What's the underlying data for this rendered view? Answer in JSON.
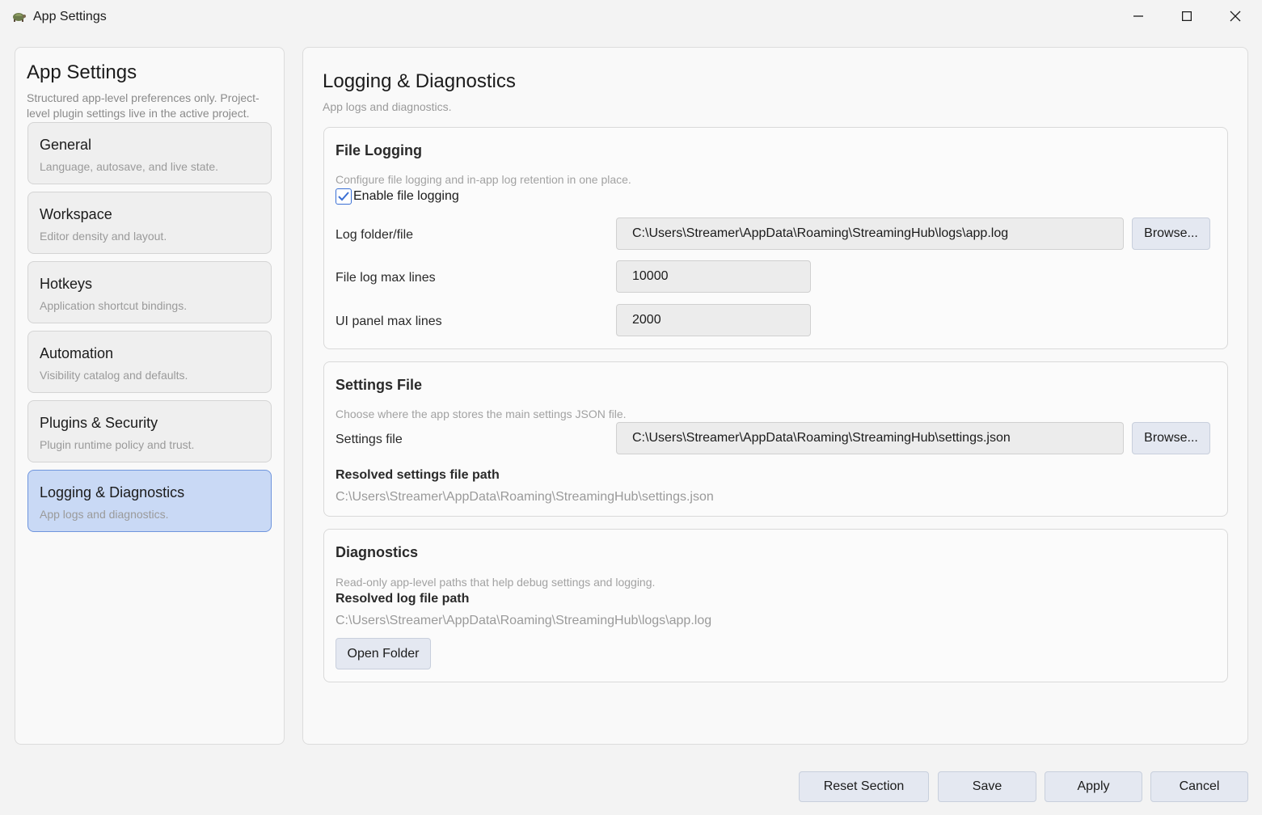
{
  "window": {
    "title": "App Settings",
    "icon": "turtle-app-icon"
  },
  "sidebar": {
    "title": "App Settings",
    "description": "Structured app-level preferences only. Project-level plugin settings live in the active project.",
    "items": [
      {
        "label": "General",
        "sub": "Language, autosave, and live state.",
        "active": false
      },
      {
        "label": "Workspace",
        "sub": "Editor density and layout.",
        "active": false
      },
      {
        "label": "Hotkeys",
        "sub": "Application shortcut bindings.",
        "active": false
      },
      {
        "label": "Automation",
        "sub": "Visibility catalog and defaults.",
        "active": false
      },
      {
        "label": "Plugins & Security",
        "sub": "Plugin runtime policy and trust.",
        "active": false
      },
      {
        "label": "Logging & Diagnostics",
        "sub": "App logs and diagnostics.",
        "active": true
      }
    ]
  },
  "main": {
    "title": "Logging & Diagnostics",
    "description": "App logs and diagnostics.",
    "file_logging": {
      "title": "File Logging",
      "description": "Configure file logging and in-app log retention in one place.",
      "enable_label": "Enable file logging",
      "enabled": true,
      "log_path_label": "Log folder/file",
      "log_path_value": "C:\\Users\\Streamer\\AppData\\Roaming\\StreamingHub\\logs\\app.log",
      "browse_label": "Browse...",
      "max_lines_label": "File log max lines",
      "max_lines_value": "10000",
      "ui_max_lines_label": "UI panel max lines",
      "ui_max_lines_value": "2000"
    },
    "settings_file": {
      "title": "Settings File",
      "description": "Choose where the app stores the main settings JSON file.",
      "file_label": "Settings file",
      "file_value": "C:\\Users\\Streamer\\AppData\\Roaming\\StreamingHub\\settings.json",
      "browse_label": "Browse...",
      "resolved_label": "Resolved settings file path",
      "resolved_value": "C:\\Users\\Streamer\\AppData\\Roaming\\StreamingHub\\settings.json"
    },
    "diagnostics": {
      "title": "Diagnostics",
      "description": "Read-only app-level paths that help debug settings and logging.",
      "resolved_log_label": "Resolved log file path",
      "resolved_log_value": "C:\\Users\\Streamer\\AppData\\Roaming\\StreamingHub\\logs\\app.log",
      "open_folder_label": "Open Folder"
    }
  },
  "footer": {
    "reset_label": "Reset Section",
    "save_label": "Save",
    "apply_label": "Apply",
    "cancel_label": "Cancel"
  },
  "colors": {
    "accent": "#3a6fd4",
    "active_nav_bg": "#c9d9f5",
    "active_nav_border": "#6f95dd",
    "button_bg": "#e4e8f1"
  }
}
